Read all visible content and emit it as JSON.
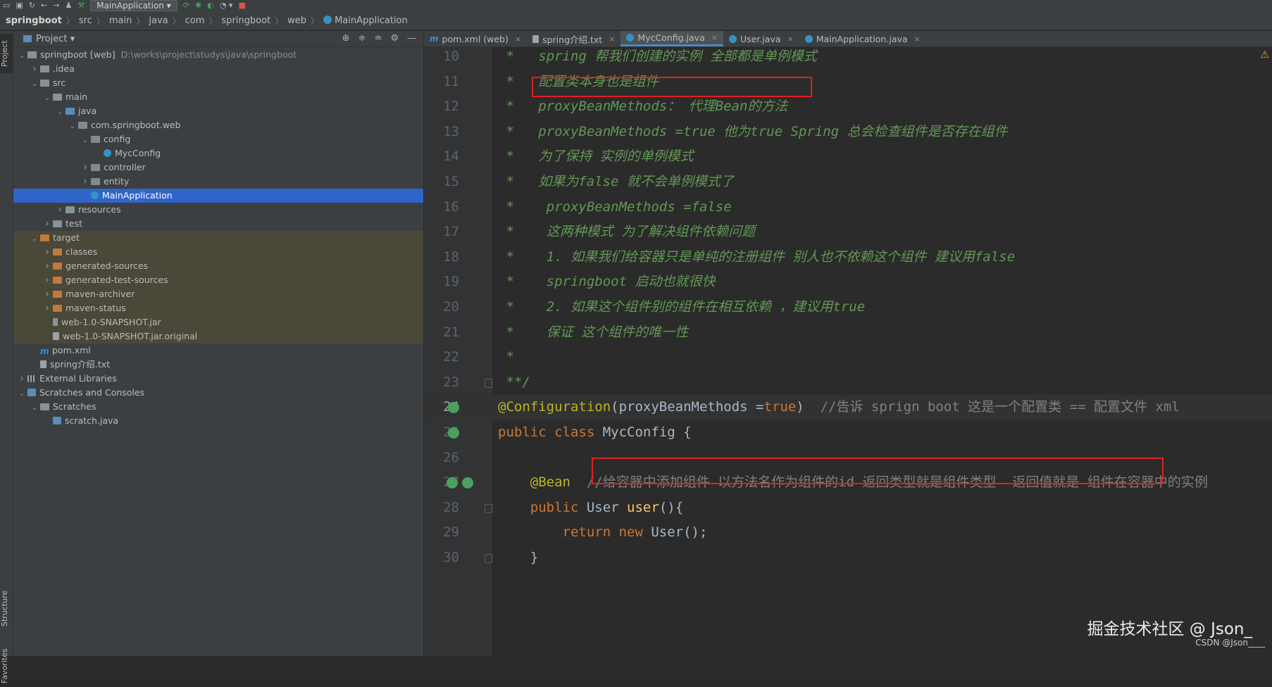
{
  "toolbar": {
    "run_config": "MainApplication"
  },
  "breadcrumb": [
    "springboot",
    "src",
    "main",
    "java",
    "com",
    "springboot",
    "web",
    "MainApplication"
  ],
  "side_tabs": {
    "project": "Project",
    "structure": "Structure",
    "favorites": "Favorites"
  },
  "project_panel": {
    "title": "Project",
    "tree": [
      {
        "label": "springboot [web]",
        "path": "D:\\works\\project\\studys\\java\\springboot",
        "depth": 0,
        "arrow": "down",
        "icon": "folder"
      },
      {
        "label": ".idea",
        "depth": 1,
        "arrow": "right",
        "icon": "folder"
      },
      {
        "label": "src",
        "depth": 1,
        "arrow": "down",
        "icon": "folder"
      },
      {
        "label": "main",
        "depth": 2,
        "arrow": "down",
        "icon": "folder"
      },
      {
        "label": "java",
        "depth": 3,
        "arrow": "down",
        "icon": "folder-blue"
      },
      {
        "label": "com.springboot.web",
        "depth": 4,
        "arrow": "down",
        "icon": "package"
      },
      {
        "label": "config",
        "depth": 5,
        "arrow": "down",
        "icon": "package"
      },
      {
        "label": "MycConfig",
        "depth": 6,
        "arrow": "",
        "icon": "class"
      },
      {
        "label": "controller",
        "depth": 5,
        "arrow": "right",
        "icon": "package"
      },
      {
        "label": "entity",
        "depth": 5,
        "arrow": "right",
        "icon": "package"
      },
      {
        "label": "MainApplication",
        "depth": 5,
        "arrow": "",
        "icon": "class",
        "selected": true
      },
      {
        "label": "resources",
        "depth": 3,
        "arrow": "right",
        "icon": "folder"
      },
      {
        "label": "test",
        "depth": 2,
        "arrow": "right",
        "icon": "folder"
      },
      {
        "label": "target",
        "depth": 1,
        "arrow": "down",
        "icon": "folder-orange",
        "excluded": true
      },
      {
        "label": "classes",
        "depth": 2,
        "arrow": "right",
        "icon": "folder-orange",
        "excluded": true
      },
      {
        "label": "generated-sources",
        "depth": 2,
        "arrow": "right",
        "icon": "folder-orange",
        "excluded": true
      },
      {
        "label": "generated-test-sources",
        "depth": 2,
        "arrow": "right",
        "icon": "folder-orange",
        "excluded": true
      },
      {
        "label": "maven-archiver",
        "depth": 2,
        "arrow": "right",
        "icon": "folder-orange",
        "excluded": true
      },
      {
        "label": "maven-status",
        "depth": 2,
        "arrow": "right",
        "icon": "folder-orange",
        "excluded": true
      },
      {
        "label": "web-1.0-SNAPSHOT.jar",
        "depth": 2,
        "arrow": "",
        "icon": "jar",
        "excluded": true
      },
      {
        "label": "web-1.0-SNAPSHOT.jar.original",
        "depth": 2,
        "arrow": "",
        "icon": "file",
        "excluded": true
      },
      {
        "label": "pom.xml",
        "depth": 1,
        "arrow": "",
        "icon": "maven"
      },
      {
        "label": "spring介绍.txt",
        "depth": 1,
        "arrow": "",
        "icon": "file"
      },
      {
        "label": "External Libraries",
        "depth": 0,
        "arrow": "right",
        "icon": "lib"
      },
      {
        "label": "Scratches and Consoles",
        "depth": 0,
        "arrow": "down",
        "icon": "scratch"
      },
      {
        "label": "Scratches",
        "depth": 1,
        "arrow": "down",
        "icon": "folder"
      },
      {
        "label": "scratch.java",
        "depth": 2,
        "arrow": "",
        "icon": "scratch"
      }
    ]
  },
  "editor_tabs": [
    {
      "label": "pom.xml (web)",
      "icon": "maven"
    },
    {
      "label": "spring介绍.txt",
      "icon": "text"
    },
    {
      "label": "MycConfig.java",
      "icon": "class",
      "active": true
    },
    {
      "label": "User.java",
      "icon": "class"
    },
    {
      "label": "MainApplication.java",
      "icon": "class"
    }
  ],
  "code_lines": [
    {
      "n": "10",
      "segs": [
        [
          "doc",
          " *   spring 帮我们创建的实例 全部都是单例模式"
        ]
      ]
    },
    {
      "n": "11",
      "segs": [
        [
          "doc",
          " *   配置类本身也是组件"
        ]
      ]
    },
    {
      "n": "12",
      "segs": [
        [
          "doc",
          " *   proxyBeanMethods： 代理Bean的方法"
        ]
      ]
    },
    {
      "n": "13",
      "segs": [
        [
          "doc",
          " *   proxyBeanMethods =true 他为true Spring 总会检查组件是否存在组件"
        ]
      ]
    },
    {
      "n": "14",
      "segs": [
        [
          "doc",
          " *   为了保持 实例的单例模式"
        ]
      ]
    },
    {
      "n": "15",
      "segs": [
        [
          "doc",
          " *   如果为false 就不会单例模式了"
        ]
      ]
    },
    {
      "n": "16",
      "segs": [
        [
          "doc",
          " *    proxyBeanMethods =false"
        ]
      ]
    },
    {
      "n": "17",
      "segs": [
        [
          "doc",
          " *    这两种模式 为了解决组件依赖问题"
        ]
      ]
    },
    {
      "n": "18",
      "segs": [
        [
          "doc",
          " *    1. 如果我们给容器只是单纯的注册组件 别人也不依赖这个组件 建议用false"
        ]
      ]
    },
    {
      "n": "19",
      "segs": [
        [
          "doc",
          " *    springboot 启动也就很快"
        ]
      ]
    },
    {
      "n": "20",
      "segs": [
        [
          "doc",
          " *    2. 如果这个组件别的组件在相互依赖 ，建议用true"
        ]
      ]
    },
    {
      "n": "21",
      "segs": [
        [
          "doc",
          " *    保证 这个组件的唯一性"
        ]
      ]
    },
    {
      "n": "22",
      "segs": [
        [
          "doc",
          " *"
        ]
      ]
    },
    {
      "n": "23",
      "segs": [
        [
          "doc",
          " **/"
        ]
      ]
    },
    {
      "n": "24",
      "segs": [
        [
          "ann",
          "@Configuration"
        ],
        [
          "pl",
          "(proxyBeanMethods ="
        ],
        [
          "kw",
          "true"
        ],
        [
          "pl",
          ")  "
        ],
        [
          "cm",
          "//告诉 sprign boot 这是一个配置类 == 配置文件 xml"
        ]
      ]
    },
    {
      "n": "25",
      "segs": [
        [
          "kw",
          "public class "
        ],
        [
          "pl",
          "MycConfig {"
        ]
      ]
    },
    {
      "n": "26",
      "segs": [
        [
          "pl",
          ""
        ]
      ]
    },
    {
      "n": "27",
      "segs": [
        [
          "pl",
          "    "
        ],
        [
          "ann",
          "@Bean"
        ],
        [
          "pl",
          "  "
        ],
        [
          "cm",
          "//给容器中添加组件 以方法名作为组件的id 返回类型就是组件类型  返回值就是 组件在容器中的实例"
        ]
      ]
    },
    {
      "n": "28",
      "segs": [
        [
          "pl",
          "    "
        ],
        [
          "kw",
          "public "
        ],
        [
          "pl",
          "User "
        ],
        [
          "fn",
          "user"
        ],
        [
          "pl",
          "(){"
        ]
      ]
    },
    {
      "n": "29",
      "segs": [
        [
          "pl",
          "        "
        ],
        [
          "kw",
          "return new "
        ],
        [
          "pl",
          "User();"
        ]
      ]
    },
    {
      "n": "30",
      "segs": [
        [
          "pl",
          "    }"
        ]
      ]
    }
  ],
  "watermark": {
    "main": "掘金技术社区 @ Json_",
    "sub": "CSDN @Json____"
  },
  "colors": {
    "doc_comment": "#629755",
    "keyword": "#cc7832",
    "annotation": "#bbb529",
    "line_comment": "#808080",
    "highlight_box": "#e02020",
    "selection": "#2f65ca"
  }
}
